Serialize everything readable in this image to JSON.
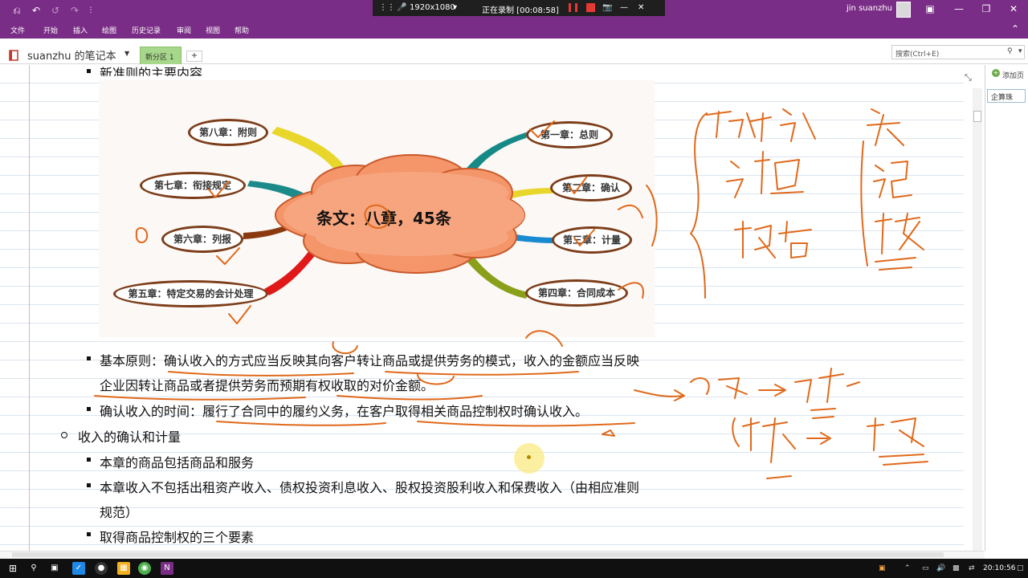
{
  "titlebar": {
    "resolution": "1920x1080",
    "recording_status": "正在录制 [00:08:58]",
    "user_name": "jin suanzhu"
  },
  "menu": {
    "items": [
      "文件",
      "开始",
      "插入",
      "绘图",
      "历史记录",
      "审阅",
      "视图",
      "帮助"
    ]
  },
  "notebook": {
    "name": "suanzhu 的笔记本",
    "section_tab": "新分区 1",
    "add_tab_label": "+",
    "search_placeholder": "搜索(Ctrl+E)"
  },
  "page_panel": {
    "add_page_label": "添加页",
    "page_title": "企算珠"
  },
  "content": {
    "heading_partial": "新准则的主要内容",
    "mindmap": {
      "center": "条文：八章，45条",
      "nodes": [
        "第八章：附则",
        "第七章：衔接规定",
        "第六章：列报",
        "第五章：特定交易的会计处理",
        "第一章：总则",
        "第二章：确认",
        "第三章：计量",
        "第四章：合同成本"
      ]
    },
    "principle_line1": "基本原则：确认收入的方式应当反映其向客户转让商品或提供劳务的模式，收入的金额应当反映",
    "principle_line2": "企业因转让商品或者提供劳务而预期有权收取的对价金额。",
    "timing": "确认收入的时间：履行了合同中的履约义务，在客户取得相关商品控制权时确认收入。",
    "sub_heading": "收入的确认和计量",
    "item1": "本章的商品包括商品和服务",
    "item2_line1": "本章收入不包括出租资产收入、债权投资利息收入、股权投资股利收入和保费收入（由相应准则",
    "item2_line2": "规范）",
    "item3": "取得商品控制权的三个要素"
  },
  "taskbar": {
    "clock": "20:10:56"
  },
  "colors": {
    "onenote_purple": "#7a2d86",
    "ink_orange": "#e0691b",
    "section_tab_green": "#a7d78a",
    "node_border": "#7d3e1a",
    "cloud_fill": "#f4956a"
  }
}
